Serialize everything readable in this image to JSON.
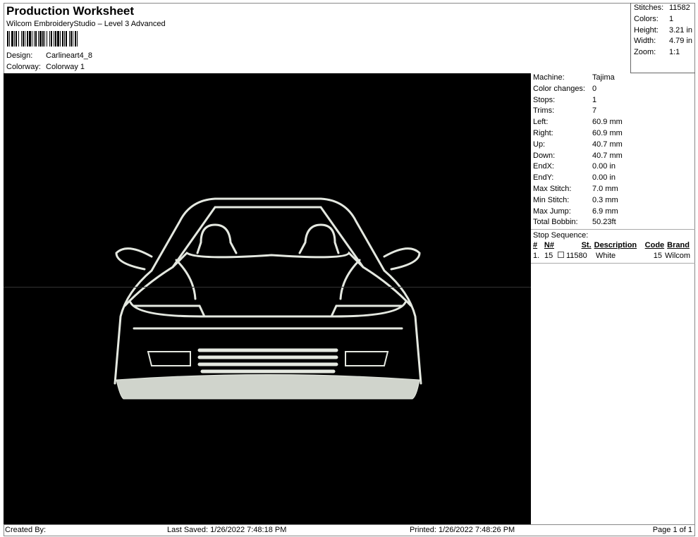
{
  "header": {
    "title": "Production Worksheet",
    "subtitle": "Wilcom EmbroideryStudio – Level 3 Advanced",
    "design_label": "Design:",
    "design_value": "Carlineart4_8",
    "colorway_label": "Colorway:",
    "colorway_value": "Colorway 1"
  },
  "stats": [
    {
      "label": "Stitches:",
      "value": "11582"
    },
    {
      "label": "Colors:",
      "value": "1"
    },
    {
      "label": "Height:",
      "value": "3.21 in"
    },
    {
      "label": "Width:",
      "value": "4.79 in"
    },
    {
      "label": "Zoom:",
      "value": "1:1"
    }
  ],
  "details": [
    {
      "label": "Machine:",
      "value": "Tajima"
    },
    {
      "label": "Color changes:",
      "value": "0"
    },
    {
      "label": "Stops:",
      "value": "1"
    },
    {
      "label": "Trims:",
      "value": "7"
    },
    {
      "label": "Left:",
      "value": "60.9 mm"
    },
    {
      "label": "Right:",
      "value": "60.9 mm"
    },
    {
      "label": "Up:",
      "value": "40.7 mm"
    },
    {
      "label": "Down:",
      "value": "40.7 mm"
    },
    {
      "label": "EndX:",
      "value": "0.00 in"
    },
    {
      "label": "EndY:",
      "value": "0.00 in"
    },
    {
      "label": "Max Stitch:",
      "value": "7.0 mm"
    },
    {
      "label": "Min Stitch:",
      "value": "0.3 mm"
    },
    {
      "label": "Max Jump:",
      "value": "6.9 mm"
    },
    {
      "label": "Total Bobbin:",
      "value": "50.23ft"
    }
  ],
  "stop_sequence": {
    "title": "Stop Sequence:",
    "headers": [
      "#",
      "N#",
      "St.",
      "Description",
      "Code",
      "Brand"
    ],
    "rows": [
      {
        "index": "1.",
        "needle": "15",
        "stitches": "11580",
        "description": "White",
        "code": "15",
        "brand": "Wilcom",
        "color": "#ffffff"
      }
    ]
  },
  "footer": {
    "created_by": "Created By:",
    "last_saved": "Last Saved: 1/26/2022 7:48:18 PM",
    "printed": "Printed: 1/26/2022 7:48:26 PM",
    "page": "Page 1 of 1"
  },
  "design_color": "#e4e8e0"
}
